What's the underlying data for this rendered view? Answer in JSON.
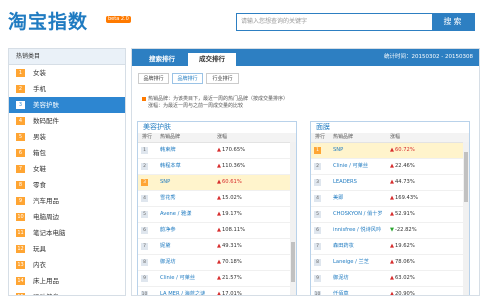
{
  "header": {
    "logo": "淘宝指数",
    "beta": "beta 2.0",
    "search_placeholder": "请输入您想查询的关键字",
    "search_button": "搜索"
  },
  "sidebar": {
    "title": "热销类目",
    "items": [
      {
        "num": "1",
        "label": "女装"
      },
      {
        "num": "2",
        "label": "手机"
      },
      {
        "num": "3",
        "label": "美容护肤"
      },
      {
        "num": "4",
        "label": "数码配件"
      },
      {
        "num": "5",
        "label": "男装"
      },
      {
        "num": "6",
        "label": "箱包"
      },
      {
        "num": "7",
        "label": "女鞋"
      },
      {
        "num": "8",
        "label": "零食"
      },
      {
        "num": "9",
        "label": "汽车用品"
      },
      {
        "num": "10",
        "label": "电脑周边"
      },
      {
        "num": "11",
        "label": "笔记本电脑"
      },
      {
        "num": "12",
        "label": "玩具"
      },
      {
        "num": "13",
        "label": "内衣"
      },
      {
        "num": "14",
        "label": "床上用品"
      },
      {
        "num": "15",
        "label": "运动健身"
      }
    ]
  },
  "main": {
    "tabs": [
      "搜索排行",
      "成交排行"
    ],
    "stat_period": "统计时间：20150302 - 20150308",
    "subtabs": [
      "品牌排行",
      "品牌排行",
      "行业排行"
    ],
    "note_line1": "热销品牌：为该类目下，最近一周的热门品牌（按成交量排序）",
    "note_line2": "涨幅：为最近一周与之前一周成交量的比较"
  },
  "panels": {
    "left": {
      "title": "美容护肤",
      "col_rank": "排行",
      "col_brand": "热销品牌",
      "col_change": "涨幅",
      "rows": [
        {
          "rank": "1",
          "brand": "韩束牌",
          "change": "170.65%",
          "dir": "up"
        },
        {
          "rank": "2",
          "brand": "韩程本草",
          "change": "110.36%",
          "dir": "up"
        },
        {
          "rank": "3",
          "brand": "SNP",
          "change": "60.61%",
          "dir": "up"
        },
        {
          "rank": "4",
          "brand": "雪花秀",
          "change": "15.02%",
          "dir": "up"
        },
        {
          "rank": "5",
          "brand": "Avene / 雅漾",
          "change": "19.17%",
          "dir": "up"
        },
        {
          "rank": "6",
          "brand": "韵净参",
          "change": "108.11%",
          "dir": "up"
        },
        {
          "rank": "7",
          "brand": "妮黛",
          "change": "49.31%",
          "dir": "up"
        },
        {
          "rank": "8",
          "brand": "御泥坊",
          "change": "70.18%",
          "dir": "up"
        },
        {
          "rank": "9",
          "brand": "Clinie / 可莱丝",
          "change": "21.57%",
          "dir": "up"
        },
        {
          "rank": "10",
          "brand": "LA MER / 海蓝之谜",
          "change": "17.01%",
          "dir": "up"
        }
      ]
    },
    "right": {
      "title": "面膜",
      "col_rank": "排行",
      "col_brand": "热销品牌",
      "col_change": "涨幅",
      "rows": [
        {
          "rank": "1",
          "brand": "SNP",
          "change": "60.72%",
          "dir": "up"
        },
        {
          "rank": "2",
          "brand": "Clinie / 可莱丝",
          "change": "22.46%",
          "dir": "up"
        },
        {
          "rank": "3",
          "brand": "LEADERS",
          "change": "44.73%",
          "dir": "up"
        },
        {
          "rank": "4",
          "brand": "美即",
          "change": "169.43%",
          "dir": "up"
        },
        {
          "rank": "5",
          "brand": "CHOSKYON / 俏十岁",
          "change": "52.91%",
          "dir": "up"
        },
        {
          "rank": "6",
          "brand": "innisfree / 悦诗风吟",
          "change": "-22.82%",
          "dir": "down"
        },
        {
          "rank": "7",
          "brand": "森田药妆",
          "change": "19.62%",
          "dir": "up"
        },
        {
          "rank": "8",
          "brand": "Laneige / 兰芝",
          "change": "78.06%",
          "dir": "up"
        },
        {
          "rank": "9",
          "brand": "御泥坊",
          "change": "63.02%",
          "dir": "up"
        },
        {
          "rank": "10",
          "brand": "仟佰草",
          "change": "20.90%",
          "dir": "up"
        }
      ]
    }
  },
  "colors": {
    "accent": "#2d7fc2",
    "highlight": "#fff4cc",
    "badge": "#ffa533",
    "up": "#d72c2c",
    "down": "#2aa530"
  }
}
